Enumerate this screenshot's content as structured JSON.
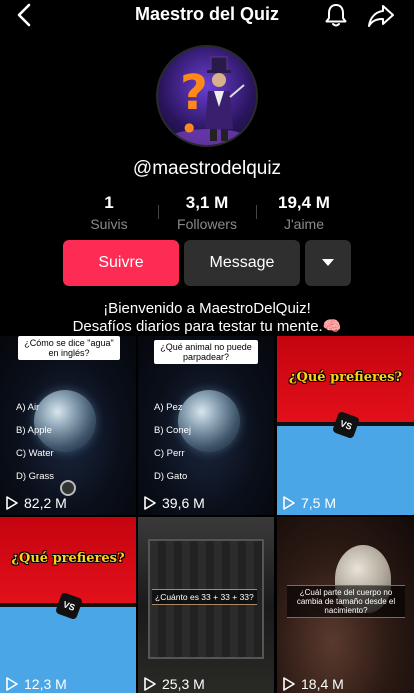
{
  "header": {
    "title": "Maestro del Quiz"
  },
  "profile": {
    "username": "@maestrodelquiz"
  },
  "stats": [
    {
      "value": "1",
      "label": "Suivis"
    },
    {
      "value": "3,1 M",
      "label": "Followers"
    },
    {
      "value": "19,4 M",
      "label": "J'aime"
    }
  ],
  "actions": {
    "follow": "Suivre",
    "message": "Message"
  },
  "bio": {
    "line1": "¡Bienvenido a MaestroDelQuiz!",
    "line2": "Desafíos diarios para testar tu mente.🧠"
  },
  "videos": [
    {
      "views": "82,2 M",
      "question": "¿Cómo se dice \"agua\" en inglés?",
      "options": [
        "A) Air",
        "B) Apple",
        "C) Water",
        "D) Grass"
      ]
    },
    {
      "views": "39,6 M",
      "question": "¿Qué animal no puede parpadear?",
      "options": [
        "A) Pez",
        "B) Conej",
        "C) Perr",
        "D) Gato"
      ]
    },
    {
      "views": "7,5 M",
      "headline": "¿Qué prefieres?",
      "badge": "VS"
    },
    {
      "views": "12,3 M",
      "headline": "¿Qué prefieres?",
      "badge": "VS"
    },
    {
      "views": "25,3 M",
      "question": "¿Cuánto es 33 + 33 + 33?"
    },
    {
      "views": "18,4 M",
      "question": "¿Cuál parte del cuerpo no cambia de tamaño desde el nacimiento?"
    }
  ],
  "colors": {
    "follow": "#fe2c55",
    "secondary": "#2f2f2f",
    "background": "#000000"
  }
}
